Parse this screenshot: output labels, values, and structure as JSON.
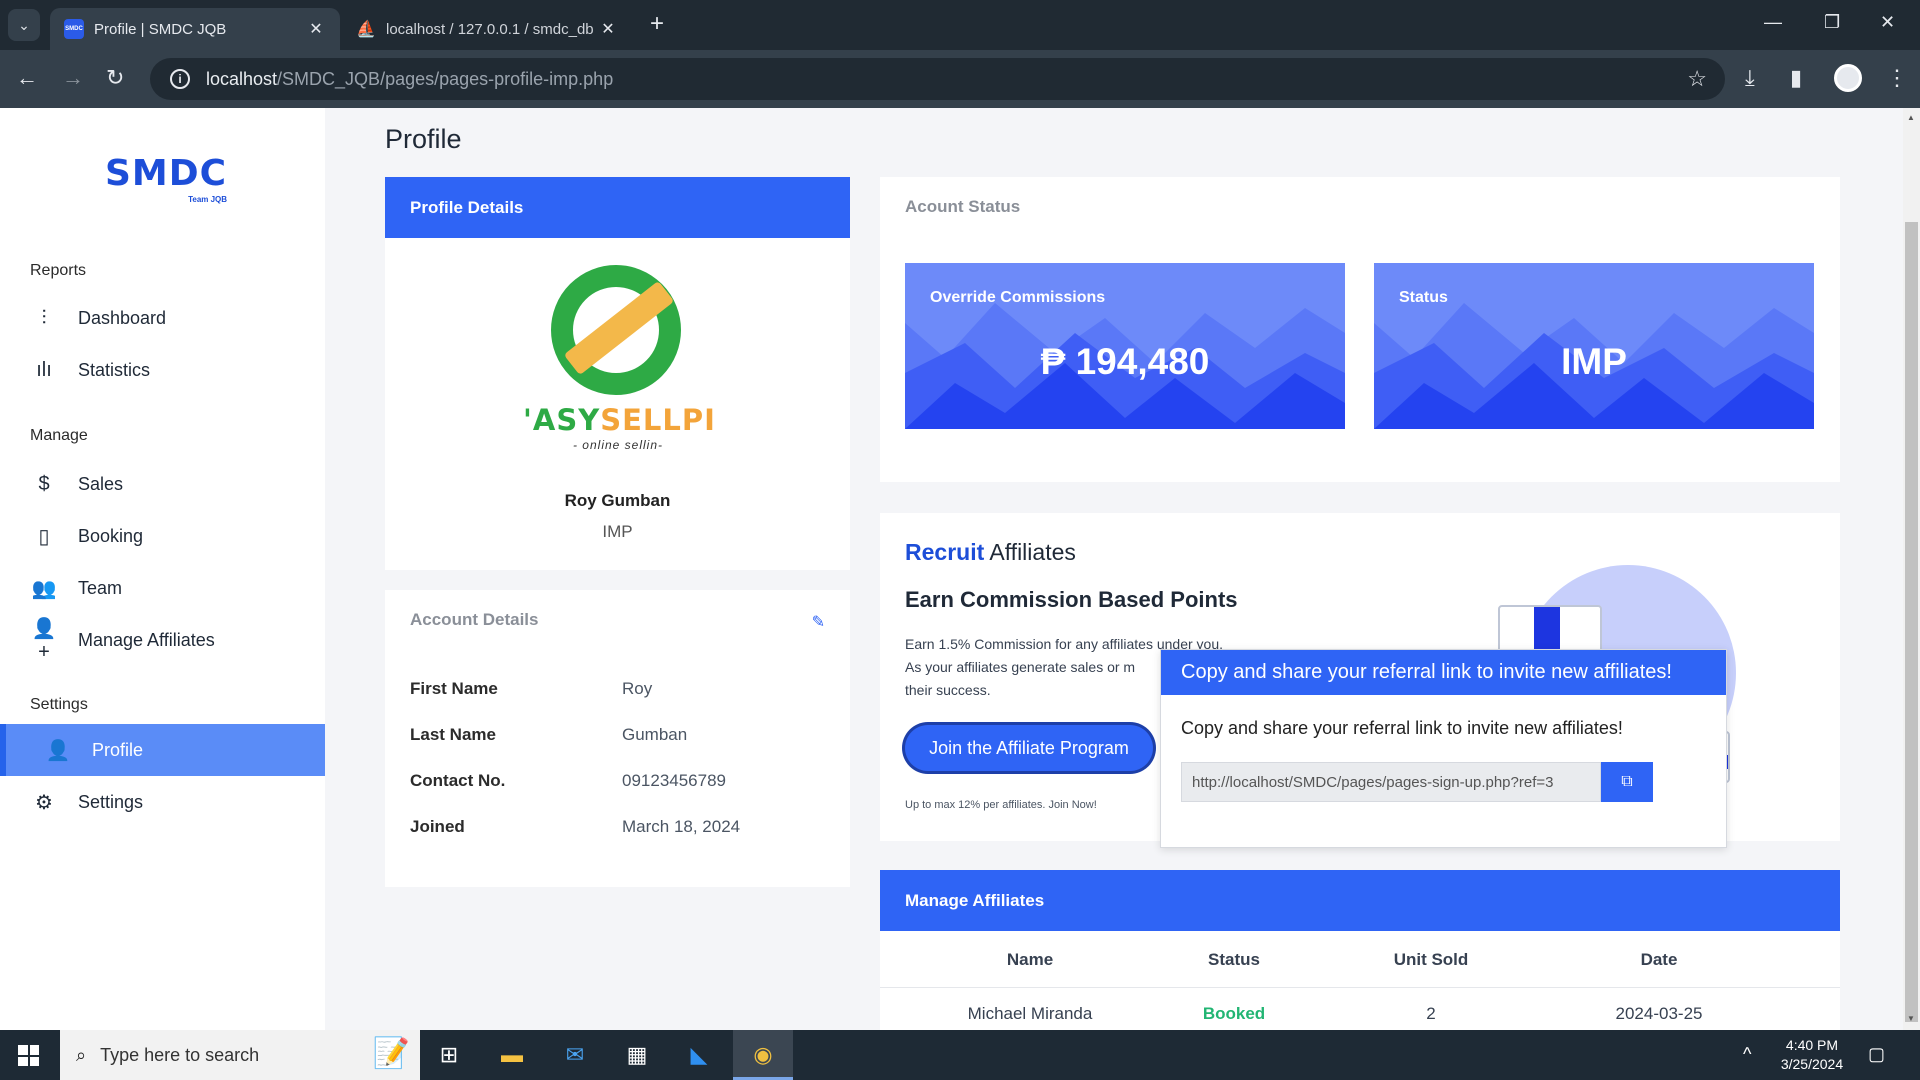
{
  "browser": {
    "tabs": [
      {
        "title": "Profile | SMDC JQB",
        "favicon_text": "SMDC"
      },
      {
        "title": "localhost / 127.0.0.1 / smdc_db",
        "favicon_text": "⛵"
      }
    ],
    "url_host": "localhost",
    "url_path": "/SMDC_JQB/pages/pages-profile-imp.php"
  },
  "sidebar": {
    "logo": "SMDC",
    "logo_sub": "Team JQB",
    "sections": [
      {
        "label": "Reports"
      },
      {
        "label": "Manage"
      },
      {
        "label": "Settings"
      }
    ],
    "items": [
      {
        "label": "Dashboard",
        "icon": "sliders-icon"
      },
      {
        "label": "Statistics",
        "icon": "bar-chart-icon"
      },
      {
        "label": "Sales",
        "icon": "dollar-icon"
      },
      {
        "label": "Booking",
        "icon": "book-icon"
      },
      {
        "label": "Team",
        "icon": "users-icon"
      },
      {
        "label": "Manage Affiliates",
        "icon": "user-plus-icon"
      },
      {
        "label": "Profile",
        "icon": "user-icon",
        "active": true
      },
      {
        "label": "Settings",
        "icon": "gear-icon"
      }
    ]
  },
  "page": {
    "title": "Profile"
  },
  "profile": {
    "header": "Profile Details",
    "brand_left": "ASY",
    "brand_right": "SELLPI",
    "brand_prefix": "'",
    "brand_tag": "- online sellin-",
    "name": "Roy Gumban",
    "role": "IMP"
  },
  "account": {
    "title": "Account Details",
    "rows": [
      {
        "label": "First Name",
        "value": "Roy"
      },
      {
        "label": "Last Name",
        "value": "Gumban"
      },
      {
        "label": "Contact No.",
        "value": "09123456789"
      },
      {
        "label": "Joined",
        "value": "March 18, 2024"
      }
    ]
  },
  "status": {
    "title": "Acount Status",
    "boxes": [
      {
        "label": "Override Commissions",
        "value": "₱ 194,480"
      },
      {
        "label": "Status",
        "value": "IMP"
      }
    ]
  },
  "recruit": {
    "title_highlight": "Recruit",
    "title_rest": " Affiliates",
    "subtitle": "Earn Commission Based Points",
    "desc_line1": "Earn 1.5% Commission for any affiliates under you.",
    "desc_line2": "As your affiliates generate sales or m",
    "desc_line3": "their success.",
    "button": "Join the Affiliate Program",
    "footnote": "Up to max 12% per affiliates. Join Now!"
  },
  "popover": {
    "header": "Copy and share your referral link to invite new affiliates!",
    "body": "Copy and share your referral link to invite new affiliates!",
    "link": "http://localhost/SMDC/pages/pages-sign-up.php?ref=3"
  },
  "affiliates": {
    "header": "Manage Affiliates",
    "columns": [
      "Name",
      "Status",
      "Unit Sold",
      "Date"
    ],
    "rows": [
      {
        "name": "Michael Miranda",
        "status": "Booked",
        "units": "2",
        "date": "2024-03-25"
      }
    ]
  },
  "taskbar": {
    "search_placeholder": "Type here to search",
    "time": "4:40 PM",
    "date": "3/25/2024"
  },
  "colors": {
    "accent": "#2f64f5",
    "sidebar_active": "#5a8cf7",
    "booked": "#22b573"
  }
}
